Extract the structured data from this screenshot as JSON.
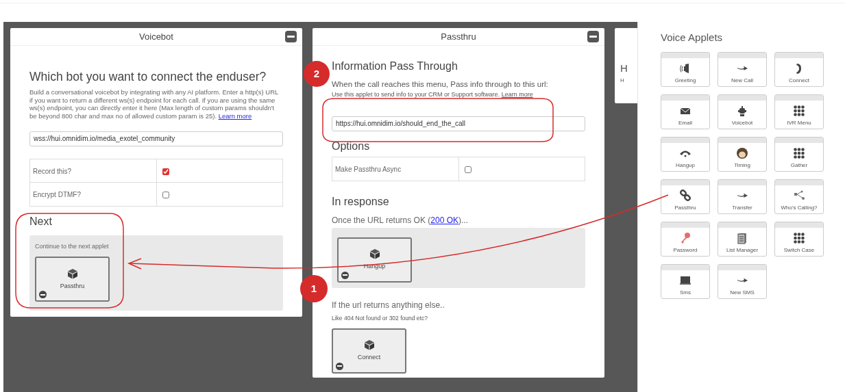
{
  "panels": [
    {
      "kind": "voicebot",
      "title": "Voicebot",
      "heading": "Which bot you want to connect the enduser?",
      "description": "Build a conversational voicebot by integrating with any AI platform. Enter a http(s) URL if you want to return a different ws(s) endpoint for each call. If you are using the same ws(s) endpoint, you can directly enter it here (Max length of custom params shouldn't be beyond 800 char and max no of allowed custom param is 25).",
      "description_link": "Learn more",
      "url_value": "wss://hui.omnidim.io/media_exotel_community",
      "options": [
        {
          "label": "Record this?",
          "checked": true
        },
        {
          "label": "Encrypt DTMF?",
          "checked": false
        }
      ],
      "next_heading": "Next",
      "next_prompt": "Continue to the next applet",
      "next_applet": "Passthru"
    },
    {
      "kind": "passthru",
      "title": "Passthru",
      "heading": "Information Pass Through",
      "prompt": "When the call reaches this menu, Pass info through to this url:",
      "hint": "Use this applet to send info to your CRM or Support software.",
      "hint_link": "Learn more",
      "url_value": "https://hui.omnidim.io/should_end_the_call",
      "options_heading": "Options",
      "options": [
        {
          "label": "Make Passthru Async",
          "checked": false
        }
      ],
      "response_heading": "In response",
      "ok_text": "Once the URL returns OK (",
      "ok_link": "200 OK",
      "ok_suffix": ")...",
      "ok_applet": "Hangup",
      "else_heading": "If the url returns anything else..",
      "else_hint": "Like 404 Not found or 302 found etc?",
      "else_applet": "Connect"
    },
    {
      "kind": "cut",
      "heading": "H",
      "text": "H"
    }
  ],
  "sidebar": {
    "title": "Voice Applets",
    "applets": [
      {
        "label": "Greeting"
      },
      {
        "label": "New Call"
      },
      {
        "label": "Connect"
      },
      {
        "label": "Email"
      },
      {
        "label": "Voicebot"
      },
      {
        "label": "IVR Menu"
      },
      {
        "label": "Hangup"
      },
      {
        "label": "Timing"
      },
      {
        "label": "Gather"
      },
      {
        "label": "Passthru"
      },
      {
        "label": "Transfer"
      },
      {
        "label": "Who's Calling?"
      },
      {
        "label": "Password"
      },
      {
        "label": "List Manager"
      },
      {
        "label": "Switch Case"
      },
      {
        "label": "Sms"
      },
      {
        "label": "New SMS"
      }
    ]
  },
  "annotations": [
    {
      "label": "1"
    },
    {
      "label": "2"
    }
  ]
}
